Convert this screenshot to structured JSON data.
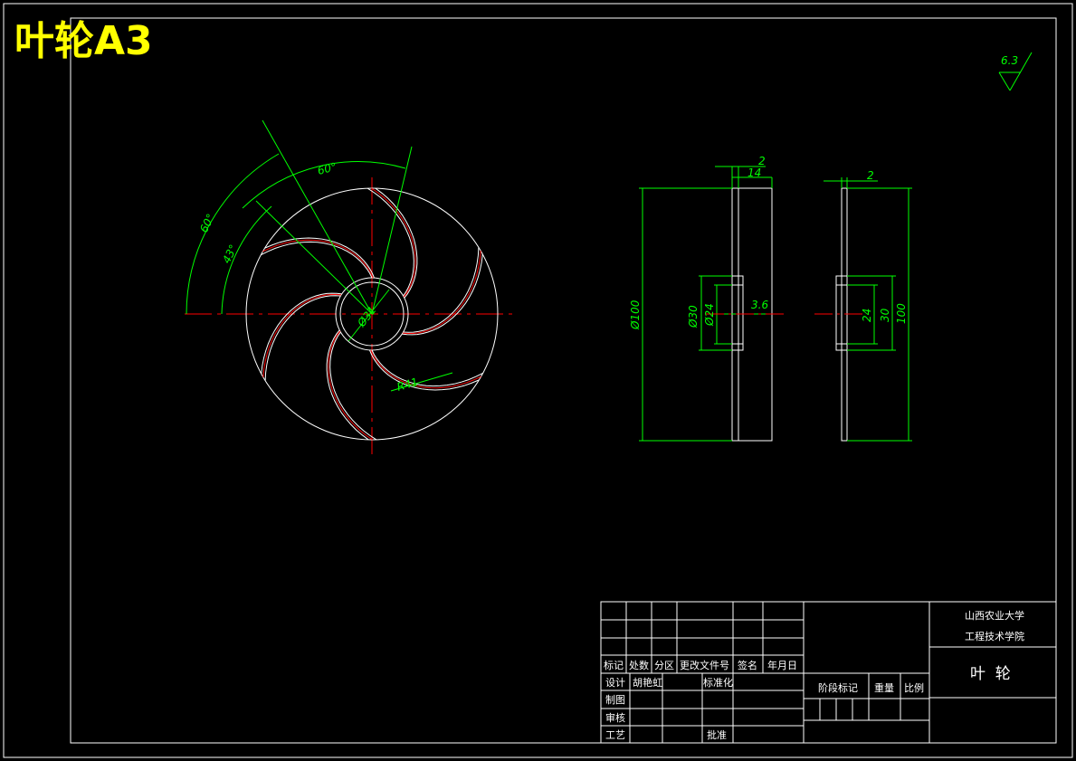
{
  "title_label": "叶轮A3",
  "roughness": "6.3",
  "front_view": {
    "angle_outer": "60°",
    "angle_mid": "60°",
    "angle_inner": "43°",
    "hub_dia": "Ø31",
    "radius": "R41"
  },
  "section_view": {
    "dim_2": "2",
    "dim_14": "14",
    "dim_100": "Ø100",
    "dim_30": "Ø30",
    "dim_24": "Ø24",
    "dim_3_6": "3.6"
  },
  "side_view": {
    "dim_2": "2",
    "dim_24": "24",
    "dim_30": "30",
    "dim_100": "100"
  },
  "title_block": {
    "school_line1": "山西农业大学",
    "school_line2": "工程技术学院",
    "part_name": "叶  轮",
    "hdr_mark": "标记",
    "hdr_count": "处数",
    "hdr_zone": "分区",
    "hdr_doc": "更改文件号",
    "hdr_sign": "签名",
    "hdr_date": "年月日",
    "designer_label": "设计",
    "designer_name": "胡艳虹",
    "standardize": "标准化",
    "drawn": "制图",
    "review": "审核",
    "process": "工艺",
    "approve": "批准",
    "stage_mark": "阶段标记",
    "weight": "重量",
    "scale": "比例"
  },
  "colors": {
    "line": "#ffffff",
    "dim": "#00ff00",
    "center": "#ff0000",
    "title": "#ffff00"
  }
}
